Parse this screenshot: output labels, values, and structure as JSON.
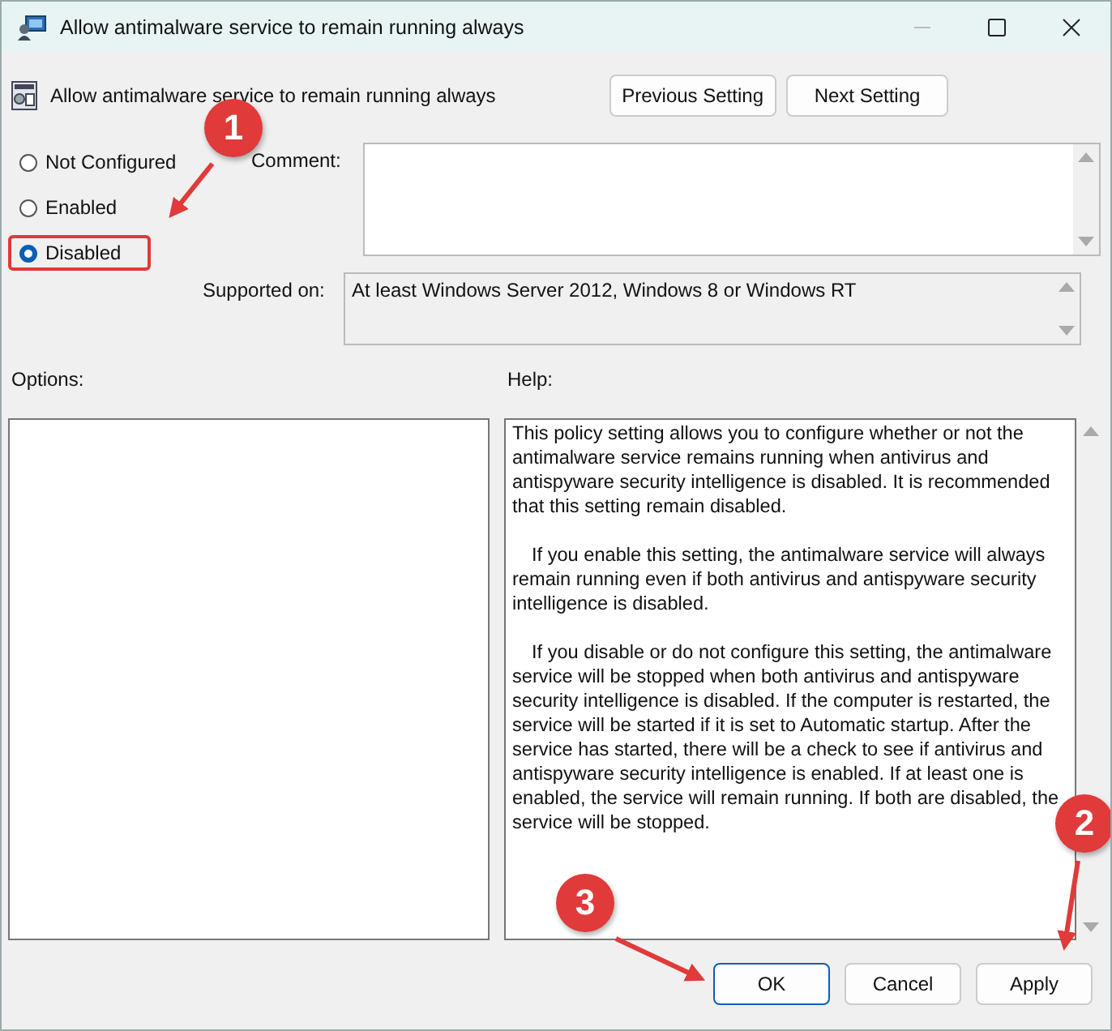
{
  "window": {
    "title": "Allow antimalware service to remain running always"
  },
  "header": {
    "title": "Allow antimalware service to remain running always",
    "buttons": [
      "Previous Setting",
      "Next Setting"
    ]
  },
  "states": [
    {
      "label": "Not Configured",
      "selected": false,
      "highlighted": false
    },
    {
      "label": "Enabled",
      "selected": false,
      "highlighted": false
    },
    {
      "label": "Disabled",
      "selected": true,
      "highlighted": true
    }
  ],
  "comment": {
    "label": "Comment:"
  },
  "supported_on": {
    "label": "Supported on:",
    "value": "At least Windows Server 2012, Windows 8 or Windows RT"
  },
  "options": {
    "label": "Options:"
  },
  "help": {
    "label": "Help:",
    "paragraphs": [
      {
        "text": "This policy setting allows you to configure whether or not the antimalware service remains running when antivirus and antispyware security intelligence is disabled. It is recommended that this setting remain disabled.",
        "indented": false
      },
      {
        "text": "If you enable this setting, the antimalware service will always remain running even if both antivirus and antispyware security intelligence is disabled.",
        "indented": true
      },
      {
        "text": "If you disable or do not configure this setting, the antimalware service will be stopped when both antivirus and antispyware security intelligence is disabled. If the computer is restarted, the service will be started if it is set to Automatic startup. After the service has started, there will be a check to see if antivirus and antispyware security intelligence is enabled. If at least one is enabled, the service will remain running. If both are disabled, the service will be stopped.",
        "indented": true
      }
    ]
  },
  "buttons": [
    {
      "label": "OK",
      "default": true
    },
    {
      "label": "Cancel",
      "default": false
    },
    {
      "label": "Apply",
      "default": false
    }
  ],
  "annotations": [
    {
      "number": "1"
    },
    {
      "number": "2"
    },
    {
      "number": "3"
    }
  ]
}
